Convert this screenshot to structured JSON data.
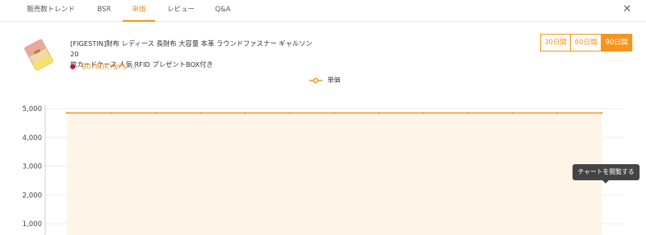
{
  "tabs": [
    {
      "label": "販売数トレンド"
    },
    {
      "label": "BSR"
    },
    {
      "label": "単価"
    },
    {
      "label": "レビュー"
    },
    {
      "label": "Q&A"
    }
  ],
  "active_tab": "単価",
  "close_label": "✕",
  "product": {
    "title_line1": "[FIGESTIN]財布 レディース 長財布 大容量 本革 ラウンドファスナー ギャルソン 20",
    "title_line2": "枚カードケース 人気 RFID プレゼントBOX付き",
    "asin": "B078DKYQFS"
  },
  "ranges": [
    {
      "label": "30日間"
    },
    {
      "label": "60日間"
    },
    {
      "label": "90日間"
    }
  ],
  "active_range": "90日間",
  "tooltip": "チャートを閲覧する",
  "colors": {
    "accent": "#f7941d",
    "line": "#f7941d",
    "area": "#fff4e8"
  },
  "chart_data": {
    "type": "area",
    "series": [
      {
        "name": "単価",
        "values": [
          4850,
          4850,
          4850,
          4850,
          4850,
          4850,
          4850,
          4850,
          4850,
          4850,
          4850,
          4850,
          4850
        ]
      }
    ],
    "y_ticks": [
      "5,000",
      "4,000",
      "3,000",
      "2,000",
      "1,000"
    ],
    "y_tick_values": [
      5000,
      4000,
      3000,
      2000,
      1000
    ],
    "ylim": [
      0,
      5000
    ],
    "grid": true,
    "legend_position": "top-center"
  }
}
